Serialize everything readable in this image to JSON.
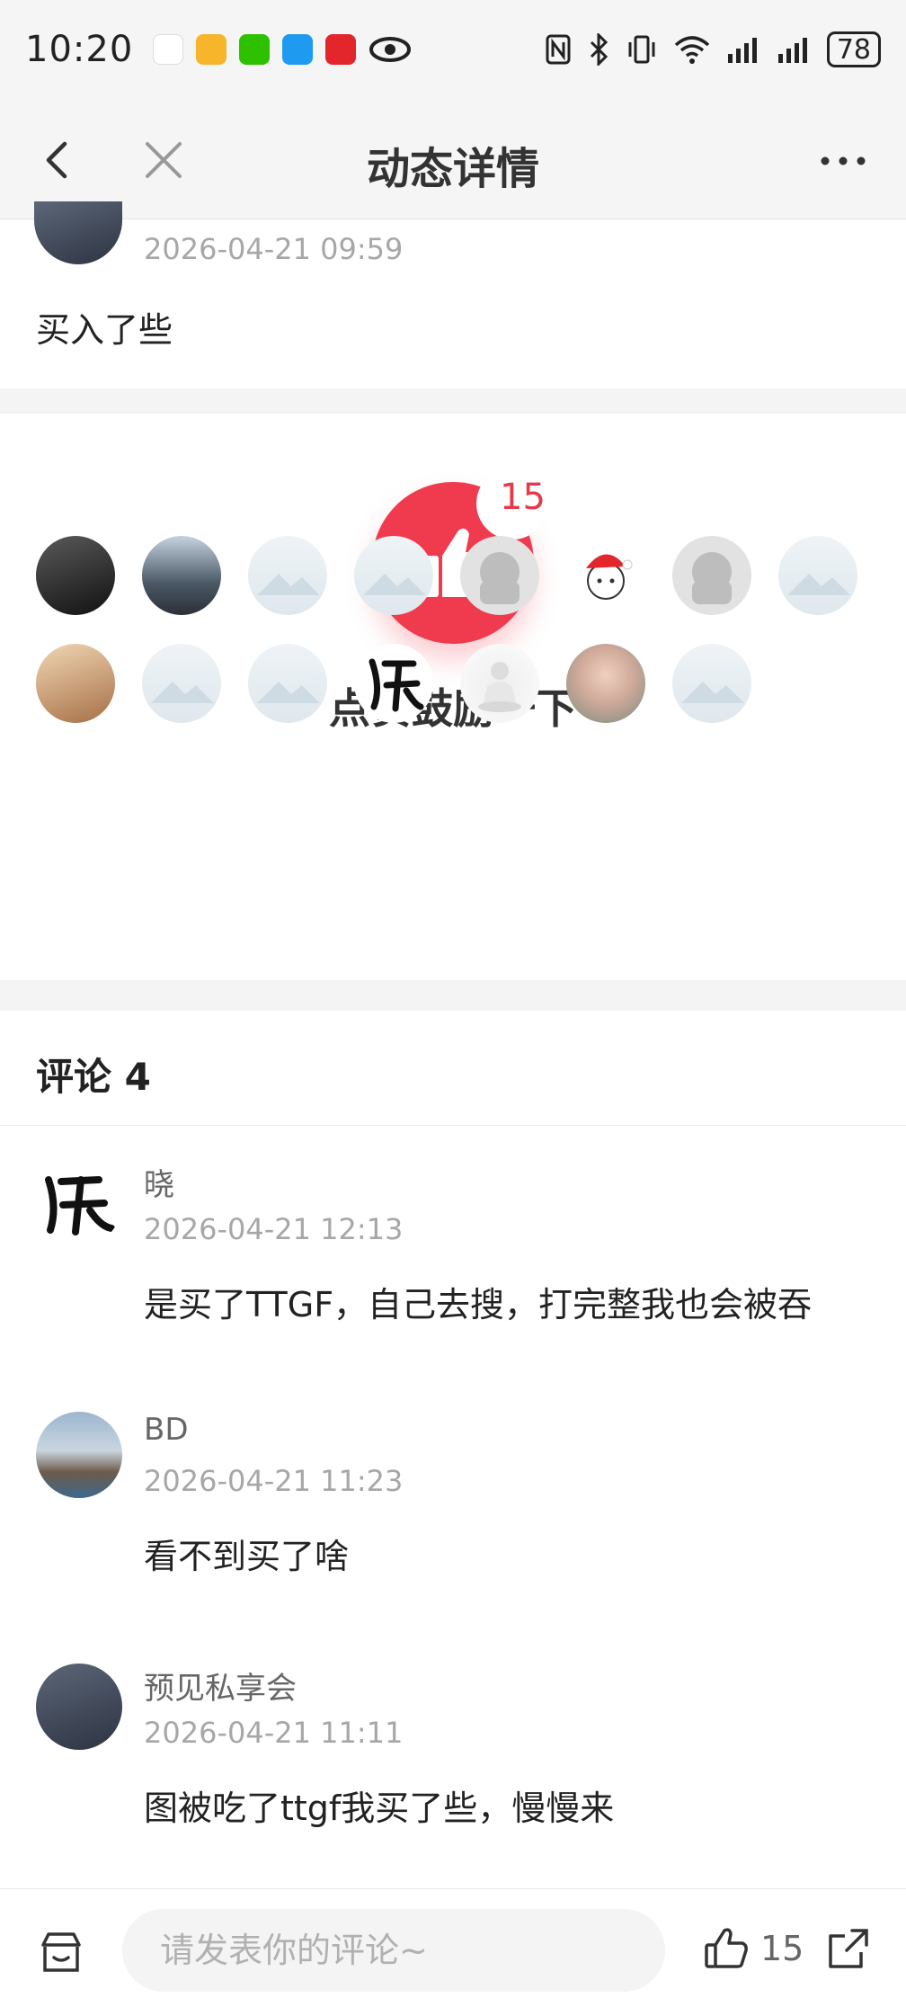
{
  "status_bar": {
    "time": "10:20",
    "battery": "78",
    "network_icons": [
      "nfc-icon",
      "bluetooth-icon",
      "vibrate-icon",
      "wifi-icon",
      "signal-icon",
      "signal-icon"
    ]
  },
  "nav": {
    "title": "动态详情",
    "back_icon": "chevron-left-icon",
    "close_icon": "close-icon",
    "more_icon": "more-horizontal-icon"
  },
  "post": {
    "time": "2026-04-21 09:59",
    "text": "买入了些"
  },
  "likes": {
    "count": "15",
    "cta": "点赞鼓励一下",
    "accent_color": "#ef3b4d"
  },
  "comments": {
    "title": "评论 4",
    "items": [
      {
        "name": "晓",
        "time": "2026-04-21 12:13",
        "text": "是买了TTGF，自己去搜，打完整我也会被吞"
      },
      {
        "name": "BD",
        "time": "2026-04-21 11:23",
        "text": "看不到买了啥"
      },
      {
        "name": "预见私享会",
        "time": "2026-04-21 11:11",
        "text": "图被吃了ttgf我买了些，慢慢来"
      }
    ]
  },
  "bottom_bar": {
    "placeholder": "请发表你的评论~",
    "like_count": "15"
  }
}
